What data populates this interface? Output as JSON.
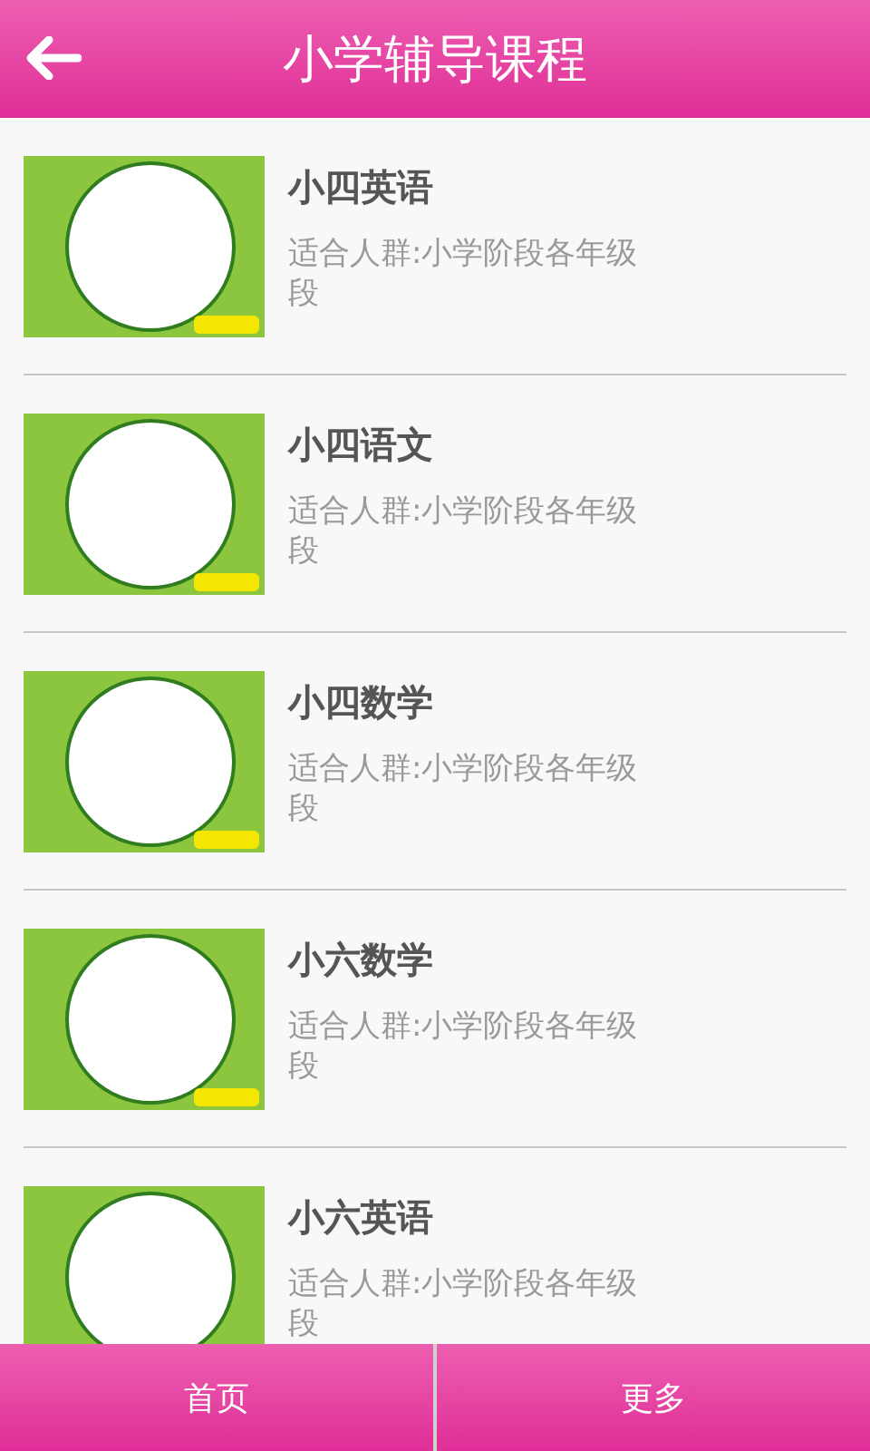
{
  "header": {
    "title": "小学辅导课程"
  },
  "courses": [
    {
      "title": "小四英语",
      "audience": "适合人群:小学阶段各年级段"
    },
    {
      "title": "小四语文",
      "audience": "适合人群:小学阶段各年级段"
    },
    {
      "title": "小四数学",
      "audience": "适合人群:小学阶段各年级段"
    },
    {
      "title": "小六数学",
      "audience": "适合人群:小学阶段各年级段"
    },
    {
      "title": "小六英语",
      "audience": "适合人群:小学阶段各年级段"
    }
  ],
  "bottom_nav": [
    {
      "label": "首页"
    },
    {
      "label": "更多"
    }
  ]
}
